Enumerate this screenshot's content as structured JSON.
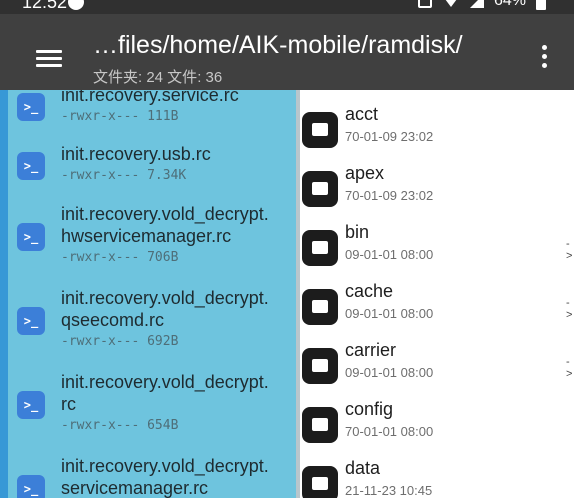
{
  "status_bar": {
    "time": "12:52",
    "battery": "64%"
  },
  "toolbar": {
    "path": "…files/home/AIK-mobile/ramdisk/",
    "summary": "文件夹: 24  文件: 36"
  },
  "left_pane": {
    "items": [
      {
        "lines": [
          "init.recovery.service.rc"
        ],
        "meta": "-rwxr-x--- 111B"
      },
      {
        "lines": [
          "init.recovery.usb.rc"
        ],
        "meta": "-rwxr-x--- 7.34K"
      },
      {
        "lines": [
          "init.recovery.vold_decrypt.",
          "hwservicemanager.rc"
        ],
        "meta": "-rwxr-x--- 706B"
      },
      {
        "lines": [
          "init.recovery.vold_decrypt.",
          "qseecomd.rc"
        ],
        "meta": "-rwxr-x--- 692B"
      },
      {
        "lines": [
          "init.recovery.vold_decrypt.",
          "rc"
        ],
        "meta": "-rwxr-x--- 654B"
      },
      {
        "lines": [
          "init.recovery.vold_decrypt.",
          "servicemanager.rc"
        ],
        "meta": ""
      }
    ]
  },
  "right_pane": {
    "items": [
      {
        "name": "acct",
        "date": "70-01-09 23:02",
        "link": false
      },
      {
        "name": "apex",
        "date": "70-01-09 23:02",
        "link": false
      },
      {
        "name": "bin",
        "date": "09-01-01 08:00",
        "link": true
      },
      {
        "name": "cache",
        "date": "09-01-01 08:00",
        "link": true
      },
      {
        "name": "carrier",
        "date": "09-01-01 08:00",
        "link": true
      },
      {
        "name": "config",
        "date": "70-01-01 08:00",
        "link": false
      },
      {
        "name": "data",
        "date": "21-11-23 10:45",
        "link": false
      }
    ],
    "link_marker": "->"
  },
  "icons": {
    "file": "script-file-icon",
    "folder": "folder-icon"
  }
}
